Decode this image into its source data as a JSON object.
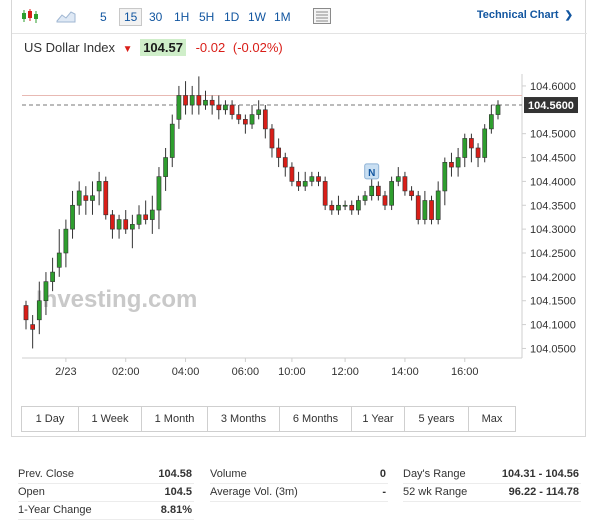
{
  "toolbar": {
    "timeframes": [
      "5",
      "15",
      "30",
      "1H",
      "5H",
      "1D",
      "1W",
      "1M"
    ],
    "active_timeframe": "15",
    "technical_chart_label": "Technical Chart"
  },
  "quote": {
    "name": "US Dollar Index",
    "price": "104.57",
    "change": "-0.02",
    "change_pct": "(-0.02%)"
  },
  "chart_data": {
    "type": "candlestick",
    "title": "",
    "watermark": "Investing.com",
    "y_ticks": [
      "104.6000",
      "104.5000",
      "104.4500",
      "104.4000",
      "104.3500",
      "104.3000",
      "104.2500",
      "104.2000",
      "104.1500",
      "104.1000",
      "104.0500"
    ],
    "y_range": [
      104.03,
      104.625
    ],
    "x_ticks": [
      "2/23",
      "02:00",
      "04:00",
      "06:00",
      "10:00",
      "12:00",
      "14:00",
      "16:00"
    ],
    "last_price_label": "104.5600",
    "event_marker": "N",
    "candles": [
      [
        104.14,
        104.11,
        104.15,
        104.09
      ],
      [
        104.1,
        104.09,
        104.12,
        104.05
      ],
      [
        104.11,
        104.15,
        104.19,
        104.08
      ],
      [
        104.15,
        104.19,
        104.21,
        104.12
      ],
      [
        104.19,
        104.21,
        104.24,
        104.17
      ],
      [
        104.22,
        104.25,
        104.3,
        104.2
      ],
      [
        104.25,
        104.3,
        104.32,
        104.22
      ],
      [
        104.3,
        104.35,
        104.38,
        104.28
      ],
      [
        104.35,
        104.38,
        104.4,
        104.33
      ],
      [
        104.37,
        104.36,
        104.39,
        104.33
      ],
      [
        104.36,
        104.37,
        104.4,
        104.33
      ],
      [
        104.38,
        104.4,
        104.42,
        104.35
      ],
      [
        104.4,
        104.33,
        104.41,
        104.32
      ],
      [
        104.33,
        104.3,
        104.34,
        104.28
      ],
      [
        104.3,
        104.32,
        104.33,
        104.28
      ],
      [
        104.32,
        104.3,
        104.34,
        104.29
      ],
      [
        104.3,
        104.31,
        104.33,
        104.26
      ],
      [
        104.31,
        104.33,
        104.35,
        104.3
      ],
      [
        104.33,
        104.32,
        104.36,
        104.31
      ],
      [
        104.32,
        104.34,
        104.37,
        104.29
      ],
      [
        104.34,
        104.41,
        104.43,
        104.3
      ],
      [
        104.41,
        104.45,
        104.47,
        104.38
      ],
      [
        104.45,
        104.52,
        104.54,
        104.43
      ],
      [
        104.53,
        104.58,
        104.6,
        104.51
      ],
      [
        104.58,
        104.56,
        104.61,
        104.54
      ],
      [
        104.56,
        104.58,
        104.6,
        104.54
      ],
      [
        104.58,
        104.56,
        104.62,
        104.54
      ],
      [
        104.56,
        104.57,
        104.59,
        104.55
      ],
      [
        104.57,
        104.56,
        104.58,
        104.54
      ],
      [
        104.56,
        104.55,
        104.58,
        104.53
      ],
      [
        104.55,
        104.56,
        104.57,
        104.54
      ],
      [
        104.56,
        104.54,
        104.57,
        104.53
      ],
      [
        104.54,
        104.53,
        104.56,
        104.52
      ],
      [
        104.53,
        104.52,
        104.54,
        104.5
      ],
      [
        104.52,
        104.54,
        104.56,
        104.51
      ],
      [
        104.54,
        104.55,
        104.57,
        104.53
      ],
      [
        104.55,
        104.51,
        104.56,
        104.49
      ],
      [
        104.51,
        104.47,
        104.52,
        104.45
      ],
      [
        104.47,
        104.45,
        104.49,
        104.43
      ],
      [
        104.45,
        104.43,
        104.46,
        104.41
      ],
      [
        104.43,
        104.4,
        104.44,
        104.39
      ],
      [
        104.4,
        104.39,
        104.42,
        104.38
      ],
      [
        104.39,
        104.4,
        104.42,
        104.38
      ],
      [
        104.4,
        104.41,
        104.42,
        104.39
      ],
      [
        104.41,
        104.4,
        104.42,
        104.39
      ],
      [
        104.4,
        104.35,
        104.41,
        104.34
      ],
      [
        104.35,
        104.34,
        104.36,
        104.33
      ],
      [
        104.34,
        104.35,
        104.37,
        104.33
      ],
      [
        104.35,
        104.35,
        104.36,
        104.34
      ],
      [
        104.35,
        104.34,
        104.36,
        104.33
      ],
      [
        104.34,
        104.36,
        104.37,
        104.33
      ],
      [
        104.36,
        104.37,
        104.38,
        104.35
      ],
      [
        104.37,
        104.39,
        104.41,
        104.36
      ],
      [
        104.39,
        104.37,
        104.4,
        104.36
      ],
      [
        104.37,
        104.35,
        104.38,
        104.34
      ],
      [
        104.35,
        104.4,
        104.41,
        104.34
      ],
      [
        104.4,
        104.41,
        104.43,
        104.39
      ],
      [
        104.41,
        104.38,
        104.42,
        104.37
      ],
      [
        104.38,
        104.37,
        104.39,
        104.36
      ],
      [
        104.37,
        104.32,
        104.38,
        104.31
      ],
      [
        104.32,
        104.36,
        104.38,
        104.31
      ],
      [
        104.36,
        104.32,
        104.37,
        104.31
      ],
      [
        104.32,
        104.38,
        104.4,
        104.31
      ],
      [
        104.38,
        104.44,
        104.45,
        104.35
      ],
      [
        104.44,
        104.43,
        104.46,
        104.41
      ],
      [
        104.43,
        104.45,
        104.47,
        104.41
      ],
      [
        104.45,
        104.49,
        104.5,
        104.43
      ],
      [
        104.49,
        104.47,
        104.5,
        104.44
      ],
      [
        104.47,
        104.45,
        104.48,
        104.43
      ],
      [
        104.45,
        104.51,
        104.52,
        104.44
      ],
      [
        104.51,
        104.54,
        104.56,
        104.5
      ],
      [
        104.54,
        104.56,
        104.57,
        104.53
      ]
    ]
  },
  "time_ranges": [
    "1 Day",
    "1 Week",
    "1 Month",
    "3 Months",
    "6 Months",
    "1 Year",
    "5 years",
    "Max"
  ],
  "stats": {
    "prev_close_label": "Prev. Close",
    "prev_close": "104.58",
    "open_label": "Open",
    "open": "104.5",
    "one_year_change_label": "1-Year Change",
    "one_year_change": "8.81%",
    "volume_label": "Volume",
    "volume": "0",
    "avg_vol_label": "Average Vol. (3m)",
    "avg_vol": "-",
    "days_range_label": "Day's Range",
    "days_range": "104.31 - 104.56",
    "wk52_range_label": "52 wk Range",
    "wk52_range": "96.22 - 114.78"
  }
}
